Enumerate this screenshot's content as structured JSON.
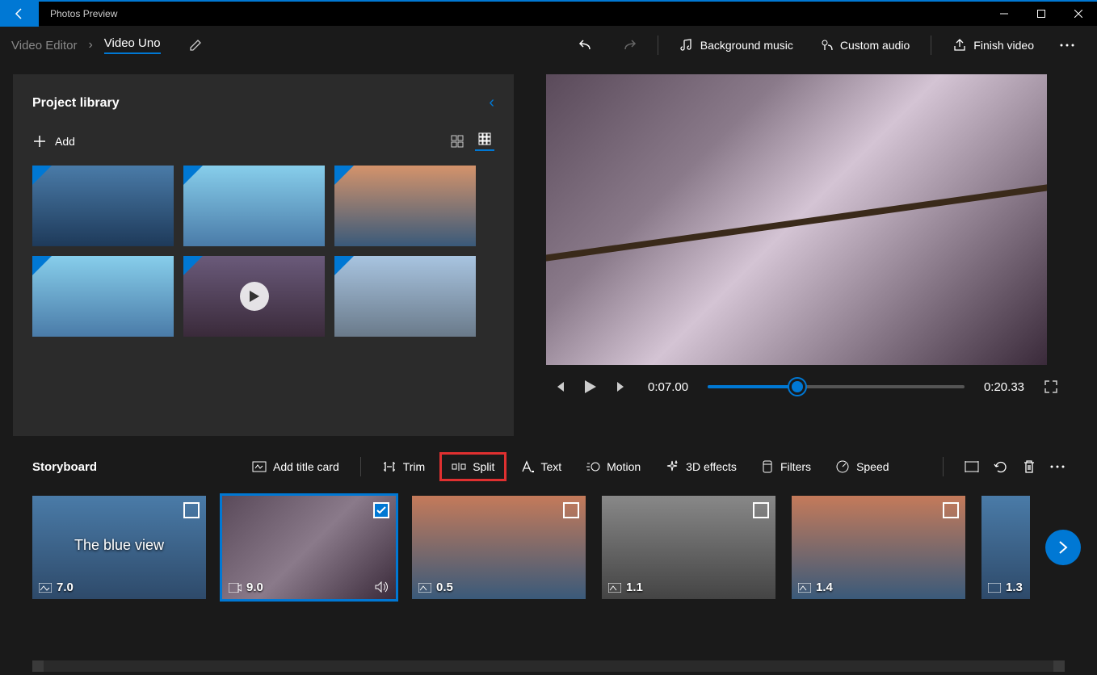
{
  "titlebar": {
    "title": "Photos Preview"
  },
  "breadcrumb": {
    "root": "Video Editor",
    "current": "Video Uno"
  },
  "header": {
    "undo": "Undo",
    "redo": "Redo",
    "bg_music": "Background music",
    "custom_audio": "Custom audio",
    "finish": "Finish video"
  },
  "library": {
    "title": "Project library",
    "add": "Add"
  },
  "preview": {
    "current_time": "0:07.00",
    "total_time": "0:20.33",
    "progress_pct": 35
  },
  "storyboard": {
    "title": "Storyboard",
    "add_title_card": "Add title card",
    "trim": "Trim",
    "split": "Split",
    "text": "Text",
    "motion": "Motion",
    "effects3d": "3D effects",
    "filters": "Filters",
    "speed": "Speed"
  },
  "clips": [
    {
      "duration": "7.0",
      "title": "The blue view",
      "selected": false,
      "type": "image"
    },
    {
      "duration": "9.0",
      "title": "",
      "selected": true,
      "type": "video",
      "sound": true
    },
    {
      "duration": "0.5",
      "title": "",
      "selected": false,
      "type": "image"
    },
    {
      "duration": "1.1",
      "title": "",
      "selected": false,
      "type": "image"
    },
    {
      "duration": "1.4",
      "title": "",
      "selected": false,
      "type": "image"
    },
    {
      "duration": "1.3",
      "title": "",
      "selected": false,
      "type": "image"
    }
  ]
}
